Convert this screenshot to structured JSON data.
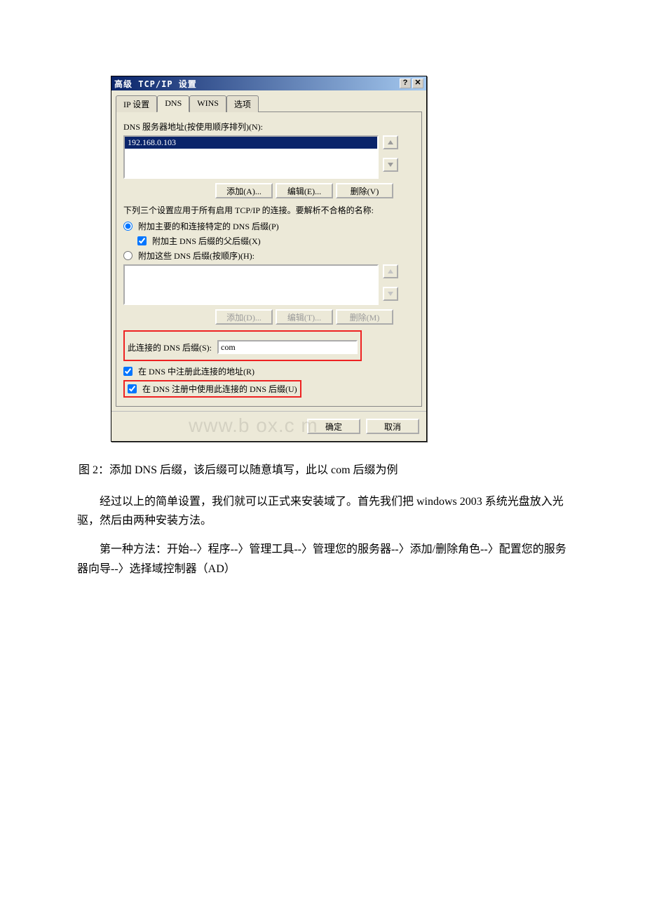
{
  "dialog": {
    "title": "高级 TCP/IP 设置",
    "tabs": {
      "ip": "IP 设置",
      "dns": "DNS",
      "wins": "WINS",
      "options": "选项"
    },
    "dns_servers_label": "DNS 服务器地址(按使用顺序排列)(N):",
    "dns_servers": [
      "192.168.0.103"
    ],
    "btn_add": "添加(A)...",
    "btn_edit": "编辑(E)...",
    "btn_remove": "删除(V)",
    "three_settings_text": "下列三个设置应用于所有启用 TCP/IP 的连接。要解析不合格的名称:",
    "radio_primary": "附加主要的和连接特定的 DNS 后缀(P)",
    "check_parent": "附加主 DNS 后缀的父后缀(X)",
    "radio_these": "附加这些 DNS 后缀(按顺序)(H):",
    "btn_add2": "添加(D)...",
    "btn_edit2": "编辑(T)...",
    "btn_remove2": "删除(M)",
    "suffix_label": "此连接的 DNS 后缀(S):",
    "suffix_value": "com",
    "check_register": "在 DNS 中注册此连接的地址(R)",
    "check_use_suffix": "在 DNS 注册中使用此连接的 DNS 后缀(U)",
    "btn_ok": "确定",
    "btn_cancel": "取消"
  },
  "watermark": "www.b    ox.c  m",
  "caption": "图 2：添加 DNS 后缀，该后缀可以随意填写，此以 com 后缀为例",
  "para1": "经过以上的简单设置，我们就可以正式来安装域了。首先我们把 windows 2003 系统光盘放入光驱，然后由两种安装方法。",
  "para2": "第一种方法：开始--〉程序--〉管理工具--〉管理您的服务器--〉添加/删除角色--〉配置您的服务器向导--〉选择域控制器（AD）"
}
